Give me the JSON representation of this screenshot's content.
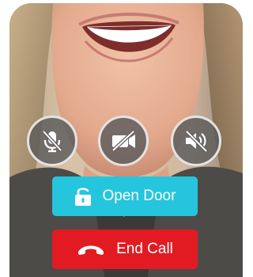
{
  "controls": {
    "mute_icon": "microphone-muted-icon",
    "camera_icon": "camera-off-icon",
    "speaker_icon": "speaker-muted-icon"
  },
  "actions": {
    "open_door_label": "Open Door",
    "open_door_icon": "unlock-icon",
    "open_door_color": "#25c6dd",
    "end_call_label": "End Call",
    "end_call_icon": "hang-up-phone-icon",
    "end_call_color": "#e21b22"
  }
}
